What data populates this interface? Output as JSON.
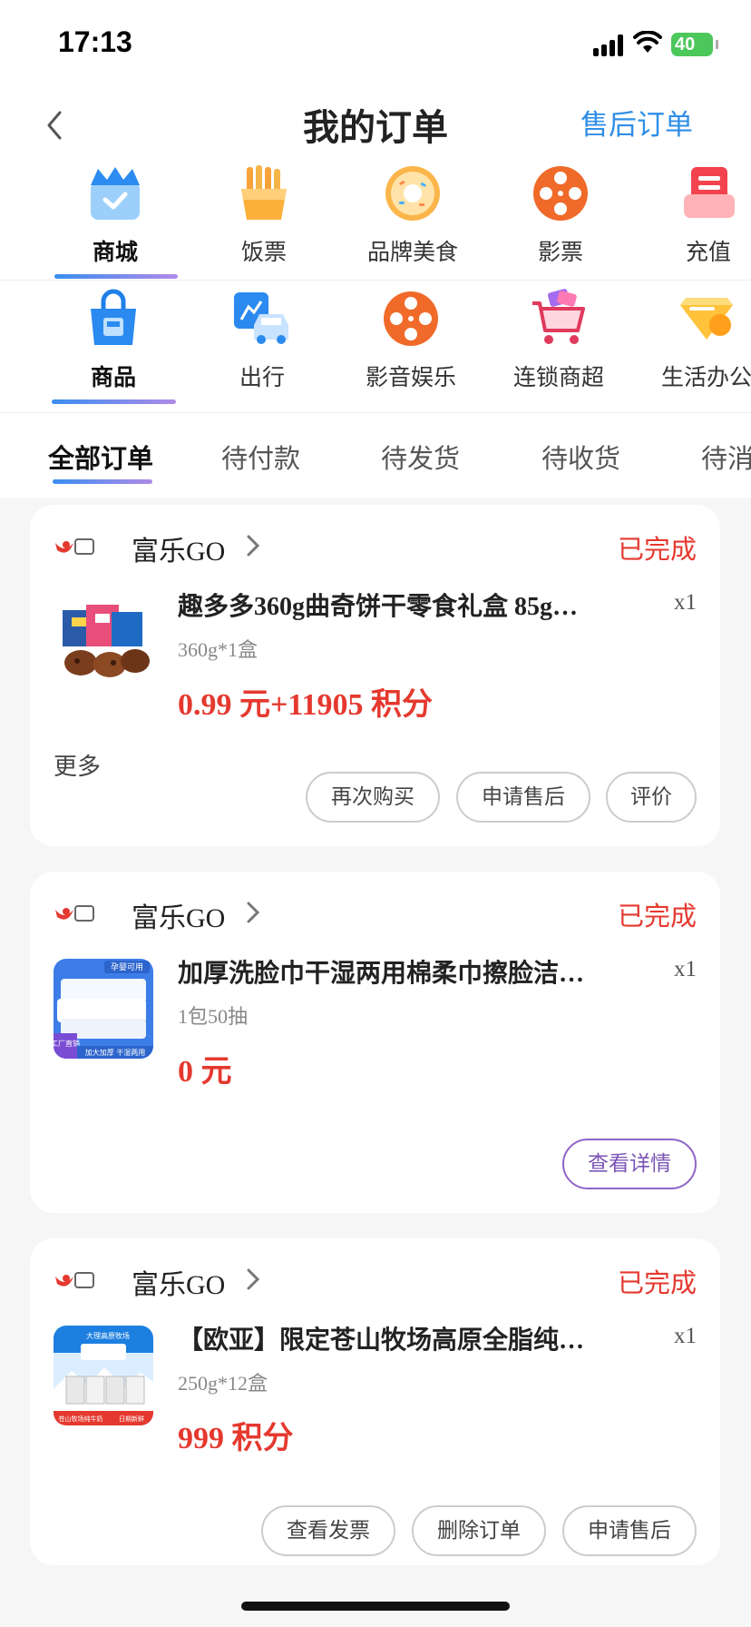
{
  "status_bar": {
    "time": "17:13",
    "battery": "40"
  },
  "header": {
    "title": "我的订单",
    "after_sales_link": "售后订单"
  },
  "categories_row1": [
    {
      "label": "商城",
      "icon": "crown-bag-icon",
      "active": true
    },
    {
      "label": "饭票",
      "icon": "fries-icon",
      "active": false
    },
    {
      "label": "品牌美食",
      "icon": "donut-icon",
      "active": false
    },
    {
      "label": "影票",
      "icon": "film-reel-icon",
      "active": false
    },
    {
      "label": "充值",
      "icon": "recharge-card-icon",
      "active": false
    }
  ],
  "categories_row2": [
    {
      "label": "商品",
      "icon": "shopping-bag-icon",
      "active": true
    },
    {
      "label": "出行",
      "icon": "car-icon",
      "active": false
    },
    {
      "label": "影音娱乐",
      "icon": "film-reel-icon",
      "active": false
    },
    {
      "label": "连锁商超",
      "icon": "shopping-cart-icon",
      "active": false
    },
    {
      "label": "生活办公",
      "icon": "coupon-gem-icon",
      "active": false
    }
  ],
  "order_tabs": [
    {
      "label": "全部订单",
      "active": true
    },
    {
      "label": "待付款",
      "active": false
    },
    {
      "label": "待发货",
      "active": false
    },
    {
      "label": "待收货",
      "active": false
    },
    {
      "label": "待消费",
      "active": false
    }
  ],
  "orders": [
    {
      "shop": "富乐GO",
      "status": "已完成",
      "product_name": "趣多多360g曲奇饼干零食礼盒 85g…",
      "quantity": "x1",
      "spec": "360g*1盒",
      "price": "0.99 元+11905 积分",
      "more_label": "更多",
      "actions": [
        "再次购买",
        "申请售后",
        "评价"
      ]
    },
    {
      "shop": "富乐GO",
      "status": "已完成",
      "product_name": "加厚洗脸巾干湿两用棉柔巾擦脸洁…",
      "quantity": "x1",
      "spec": "1包50抽",
      "price": "0 元",
      "thumb_text": [
        "孕婴可用",
        "工厂直销",
        "加大加厚 干湿两用"
      ],
      "actions": [
        "查看详情"
      ]
    },
    {
      "shop": "富乐GO",
      "status": "已完成",
      "product_name": "【欧亚】限定苍山牧场高原全脂纯…",
      "quantity": "x1",
      "spec": "250g*12盒",
      "price": "999 积分",
      "thumb_text": [
        "大理高原牧场",
        "苍山牧场纯牛奶",
        "日期新鲜"
      ],
      "actions": [
        "查看发票",
        "删除订单",
        "申请售后"
      ]
    }
  ],
  "colors": {
    "accent_blue": "#2f8ee6",
    "status_red": "#e5392f",
    "price_red": "#e5392f",
    "purple": "#7a55b5"
  }
}
